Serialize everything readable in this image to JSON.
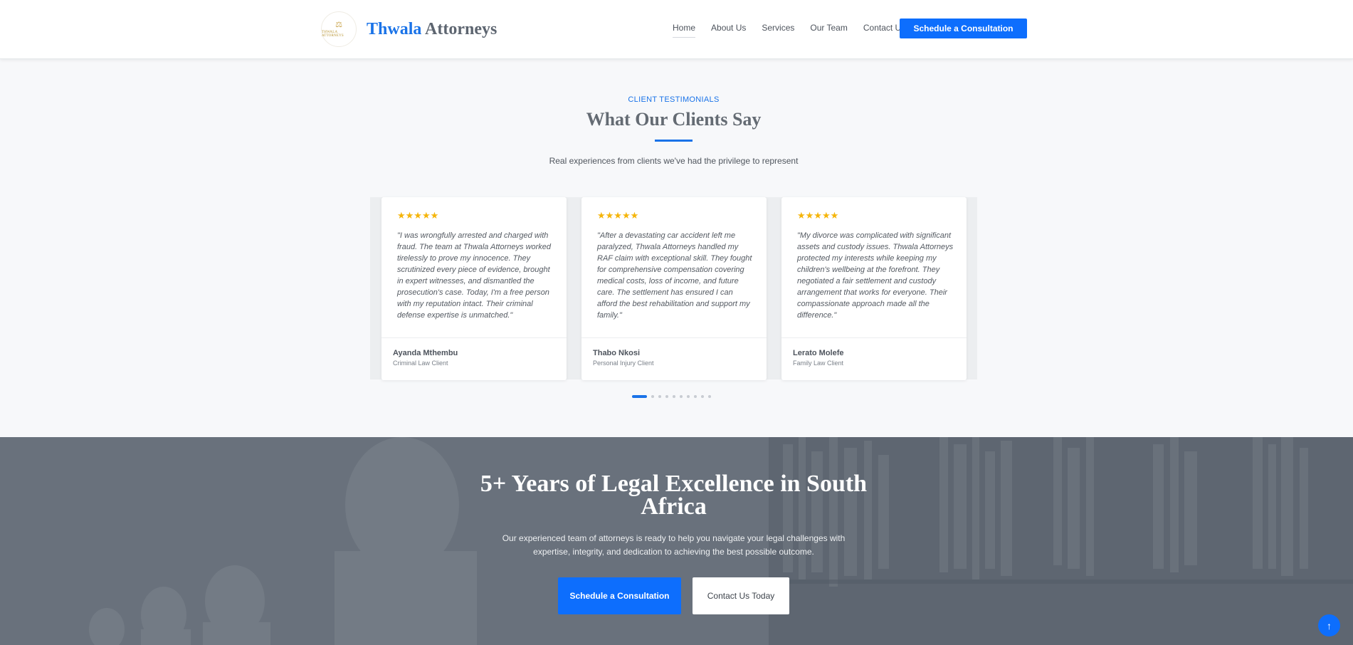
{
  "brand": {
    "name_primary": "Thwala",
    "name_secondary": "Attorneys",
    "logo_text": "THWALA ATTORNEYS",
    "logo_icon": "scales-of-justice-icon"
  },
  "nav": {
    "items": [
      {
        "label": "Home",
        "active": true
      },
      {
        "label": "About Us"
      },
      {
        "label": "Services"
      },
      {
        "label": "Our Team"
      },
      {
        "label": "Contact Us"
      }
    ],
    "cta_label": "Schedule a Consultation"
  },
  "testimonials": {
    "eyebrow": "CLIENT TESTIMONIALS",
    "title": "What Our Clients Say",
    "subtitle": "Real experiences from clients we've had the privilege to represent",
    "items": [
      {
        "rating": 5,
        "stars": "★★★★★",
        "quote": "\"I was wrongfully arrested and charged with fraud. The team at Thwala Attorneys worked tirelessly to prove my innocence. They scrutinized every piece of evidence, brought in expert witnesses, and dismantled the prosecution's case. Today, I'm a free person with my reputation intact. Their criminal defense expertise is unmatched.\"",
        "name": "Ayanda Mthembu",
        "role": "Criminal Law Client"
      },
      {
        "rating": 5,
        "stars": "★★★★★",
        "quote": "\"After a devastating car accident left me paralyzed, Thwala Attorneys handled my RAF claim with exceptional skill. They fought for comprehensive compensation covering medical costs, loss of income, and future care. The settlement has ensured I can afford the best rehabilitation and support my family.\"",
        "name": "Thabo Nkosi",
        "role": "Personal Injury Client"
      },
      {
        "rating": 5,
        "stars": "★★★★★",
        "quote": "\"My divorce was complicated with significant assets and custody issues. Thwala Attorneys protected my interests while keeping my children's wellbeing at the forefront. They negotiated a fair settlement and custody arrangement that works for everyone. Their compassionate approach made all the difference.\"",
        "name": "Lerato Molefe",
        "role": "Family Law Client"
      }
    ],
    "pagination": {
      "total": 10,
      "active": 1
    }
  },
  "hero": {
    "title_line1": "5+ Years of Legal Excellence in South",
    "title_line2": "Africa",
    "text": "Our experienced team of attorneys is ready to help you navigate your legal challenges with expertise, integrity, and dedication to achieving the best possible outcome.",
    "primary_label": "Schedule a Consultation",
    "secondary_label": "Contact Us Today"
  },
  "colors": {
    "accent": "#0d6efd",
    "star": "#f5b50a",
    "brand_blue": "#1a73e8"
  },
  "icons": {
    "back_to_top": "arrow-up-icon",
    "star": "star-icon"
  }
}
